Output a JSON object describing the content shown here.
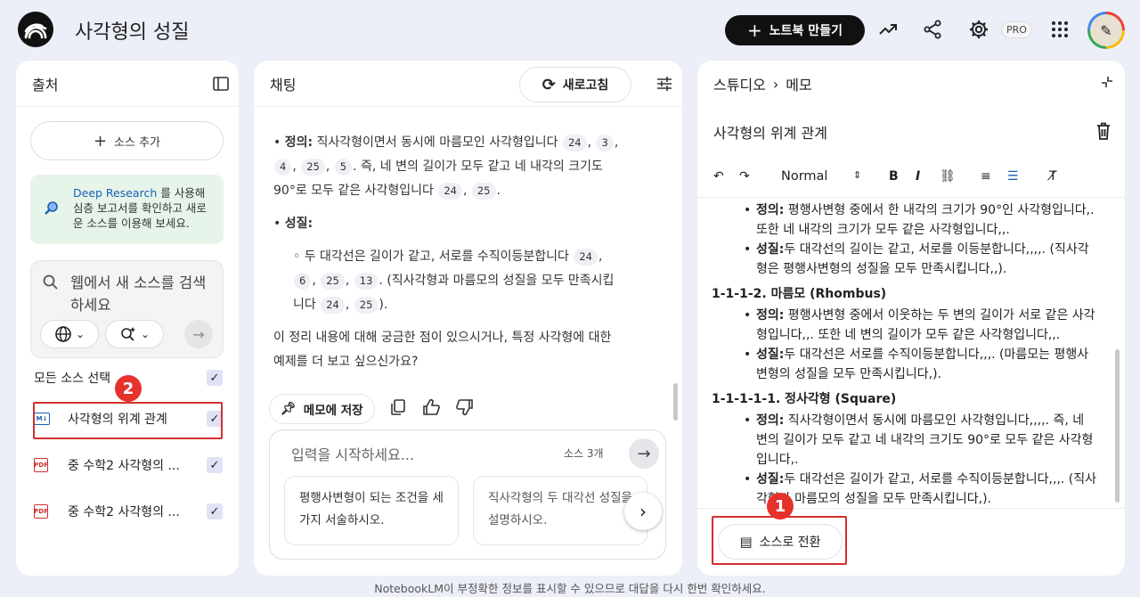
{
  "app": {
    "title": "사각형의 성질",
    "new_notebook_label": "노트북 만들기",
    "pro_label": "PRO"
  },
  "sources_panel": {
    "title": "출처",
    "add_source_label": "소스 추가",
    "deep_research": {
      "link_text": "Deep Research",
      "text": "를 사용해 심층 보고서를 확인하고 새로운 소스를 이용해 보세요."
    },
    "web_search_placeholder": "웹에서 새 소스를 검색하세요",
    "select_all_label": "모든 소스 선택",
    "items": [
      {
        "label": "사각형의 위계 관계",
        "icon": "markdown-note-icon",
        "checked": true
      },
      {
        "label": "중 수학2 사각형의 ...",
        "icon": "pdf-icon",
        "checked": true
      },
      {
        "label": "중 수학2 사각형의 ...",
        "icon": "pdf-icon",
        "checked": true
      }
    ]
  },
  "chat_panel": {
    "title": "채팅",
    "refresh_label": "새로고침",
    "p1_label": "정의:",
    "p1_text_a": " 직사각형이면서 동시에 마름모인 사각형입니다",
    "p1_cites_a": [
      "24"
    ],
    "p1_cites_b": [
      "3",
      "4",
      "25",
      "5"
    ],
    "p1_text_b": ". 즉, 네 변의 길이가 모두 같고 네 내각의 크기도 90°로 모두 같은 사각형입니다",
    "p1_cites_c": [
      "24",
      "25"
    ],
    "p2_label": "성질:",
    "p3_text_a": "두 대각선은 길이가 같고, 서로를 수직이등분합니다",
    "p3_cites_a": [
      "24"
    ],
    "p3_cites_b": [
      "6",
      "25",
      "13"
    ],
    "p3_text_b": ". (직사각형과 마름모의 성질을 모두 만족시킵니다",
    "p3_cites_c": [
      "24",
      "25"
    ],
    "p4_text": "이 정리 내용에 대해 궁금한 점이 있으시거나, 특정 사각형에 대한 예제를 더 보고 싶으신가요?",
    "save_note_label": "메모에 저장",
    "input_placeholder": "입력을 시작하세요...",
    "source_count": "소스 3개",
    "suggestions": [
      "평행사변형이 되는 조건을 세 가지 서술하시오.",
      "직사각형의 두 대각선 성질을 설명하시오."
    ]
  },
  "studio_panel": {
    "breadcrumb_root": "스튜디오",
    "breadcrumb_current": "메모",
    "note_title": "사각형의 위계 관계",
    "format_select": "Normal",
    "content": {
      "rect_def_label": "정의:",
      "rect_def": " 평행사변형 중에서 한 내각의 크기가 90°인 사각형입니다,. 또한 네 내각의 크기가 모두 같은 사각형입니다,,.",
      "rect_prop_label": "성질:",
      "rect_prop": "두 대각선의 길이는 같고, 서로를 이등분합니다,,,,. (직사각형은 평행사변형의 성질을 모두 만족시킵니다,,).",
      "rhombus_heading": "1-1-1-2. 마름모 (Rhombus)",
      "rhombus_def_label": "정의:",
      "rhombus_def": " 평행사변형 중에서 이웃하는 두 변의 길이가 서로 같은 사각형입니다,,. 또한 네 변의 길이가 모두 같은 사각형입니다,,.",
      "rhombus_prop_label": "성질:",
      "rhombus_prop": "두 대각선은 서로를 수직이등분합니다,,,. (마름모는 평행사변형의 성질을 모두 만족시킵니다,).",
      "square_heading": "1-1-1-1-1. 정사각형 (Square)",
      "square_def_label": "정의:",
      "square_def": " 직사각형이면서 동시에 마름모인 사각형입니다,,,,. 즉, 네 변의 길이가 모두 같고 네 내각의 크기도 90°로 모두 같은 사각형입니다,.",
      "square_prop_label": "성질:",
      "square_prop": "두 대각선은 길이가 같고, 서로를 수직이등분합니다,,,. (직사각형과 마름모의 성질을 모두 만족시킵니다,)."
    },
    "convert_label": "소스로 전환"
  },
  "annotations": {
    "badge_1": "1",
    "badge_2": "2",
    "color": "#d32f2f"
  },
  "footer": "NotebookLM이 부정확한 정보를 표시할 수 있으므로 대답을 다시 한번 확인하세요."
}
